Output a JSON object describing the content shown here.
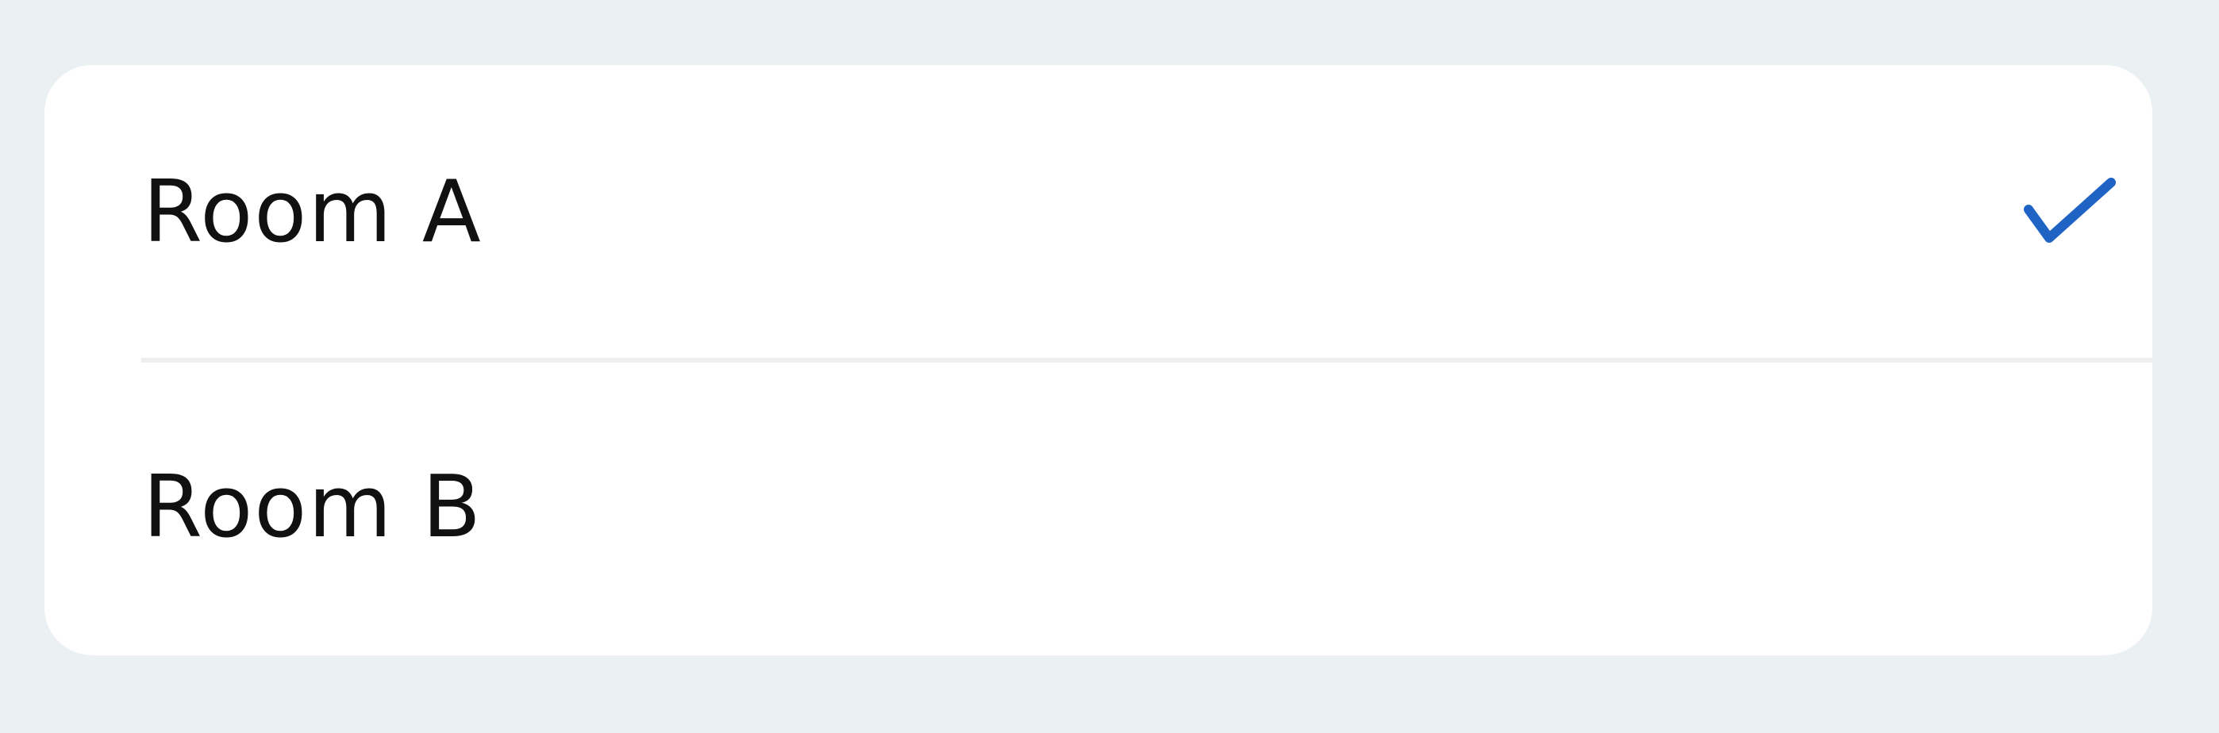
{
  "options": [
    {
      "label": "Room A",
      "selected": true
    },
    {
      "label": "Room B",
      "selected": false
    }
  ],
  "icons": {
    "selected": "checkmark-icon"
  },
  "colors": {
    "background": "#ebf0f3",
    "card": "#ffffff",
    "text": "#111111",
    "accent": "#1f63c5",
    "divider": "#eeeeee"
  }
}
